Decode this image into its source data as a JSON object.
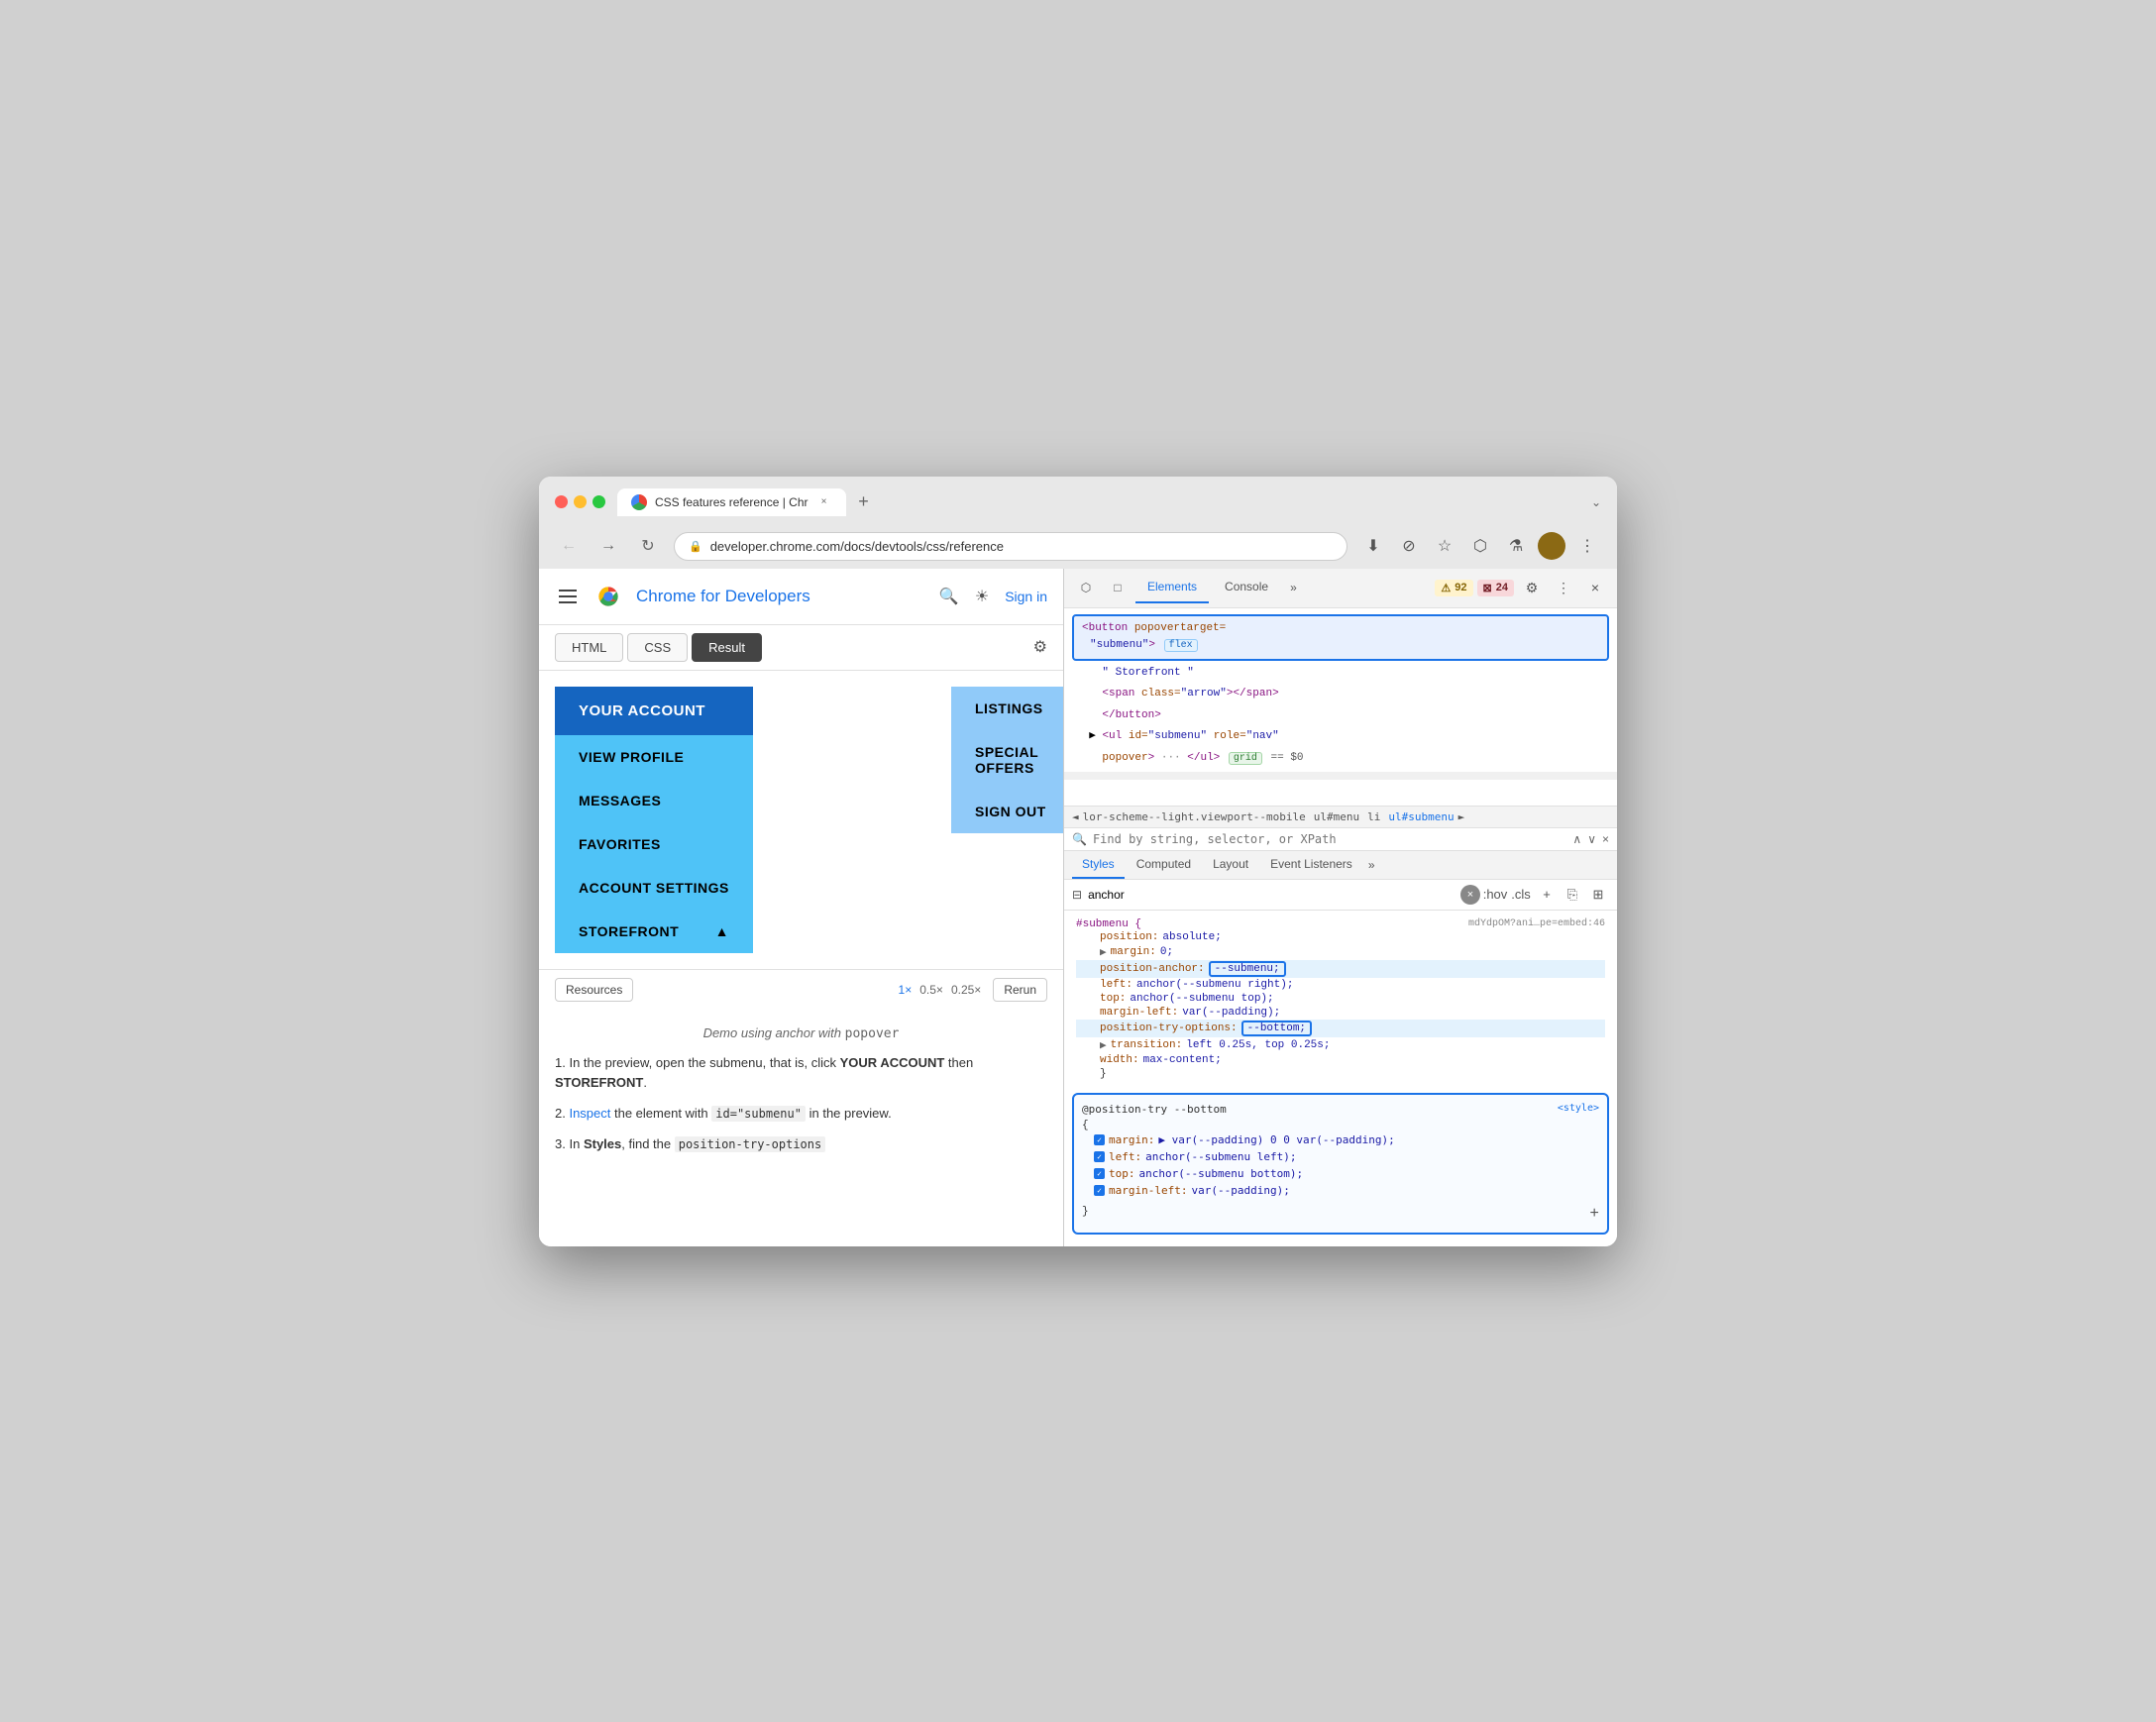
{
  "browser": {
    "tab_title": "CSS features reference | Chr",
    "tab_close": "×",
    "tab_add": "+",
    "url": "developer.chrome.com/docs/devtools/css/reference",
    "chevron": "⌄"
  },
  "nav": {
    "back": "←",
    "forward": "→",
    "refresh": "↻",
    "security_icon": "🔒"
  },
  "header": {
    "title": "Chrome for Developers",
    "sign_in": "Sign in"
  },
  "code_tabs": {
    "html": "HTML",
    "css": "CSS",
    "result": "Result"
  },
  "demo": {
    "your_account": "YOUR ACCOUNT",
    "menu_items": [
      "VIEW PROFILE",
      "MESSAGES",
      "FAVORITES",
      "ACCOUNT SETTINGS",
      "STOREFRONT"
    ],
    "storefront_arrow": "▲",
    "submenu_items": [
      "LISTINGS",
      "SPECIAL OFFERS",
      "SIGN OUT"
    ]
  },
  "controls": {
    "resources": "Resources",
    "zoom_1x": "1×",
    "zoom_05x": "0.5×",
    "zoom_025x": "0.25×",
    "rerun": "Rerun"
  },
  "description": {
    "caption_pre": "Demo using anchor with ",
    "caption_code": "popover",
    "step1_text": "In the preview, open the submenu, that is, click ",
    "step1_bold1": "YOUR ACCOUNT",
    "step1_mid": " then ",
    "step1_bold2": "STOREFRONT",
    "step1_end": ".",
    "step2_pre": "",
    "step2_link": "Inspect",
    "step2_mid": " the element with ",
    "step2_code": "id=\"submenu\"",
    "step2_end": " in the preview.",
    "step3_text": "In ",
    "step3_bold": "Styles",
    "step3_end": ", find the ",
    "step3_code": "position-try-options"
  },
  "devtools": {
    "panel_icons": [
      "⬡",
      "□",
      "×"
    ],
    "tabs": [
      "Elements",
      "Console",
      "»"
    ],
    "warning_count": "92",
    "error_count": "24",
    "settings_icon": "⚙",
    "more_icon": "⋮",
    "close": "×"
  },
  "elements_panel": {
    "line1_selected": "<button popovertarget=\"submenu\"> flex",
    "line2": "\" Storefront \"",
    "line3": "<span class=\"arrow\"></span>",
    "line4": "</button>",
    "line5": "<ul id=\"submenu\" role=\"nav\"",
    "line6": "popover> ··· </ul> grid  == $0"
  },
  "breadcrumb": {
    "items": [
      "◄",
      "lor-scheme--light.viewport--mobile",
      "ul#menu",
      "li",
      "ul#submenu",
      "►"
    ]
  },
  "search": {
    "placeholder": "Find by string, selector, or XPath",
    "up": "∧",
    "down": "∨",
    "close": "×"
  },
  "styles_tabs": {
    "tabs": [
      "Styles",
      "Computed",
      "Layout",
      "Event Listeners",
      "»"
    ]
  },
  "filter": {
    "placeholder": "anchor",
    "pseudo_class": ":hov",
    "cls": ".cls",
    "plus": "+",
    "copy_icon": "⎘",
    "layout_icon": "⊞"
  },
  "css_rules": {
    "selector": "#submenu {",
    "file_ref": "mdYdpOM?ani…pe=embed:46",
    "properties": [
      {
        "name": "position:",
        "value": "absolute;",
        "highlight": false
      },
      {
        "name": "margin:",
        "value": "▶ 0;",
        "highlight": false
      },
      {
        "name": "position-anchor:",
        "value": "--submenu;",
        "highlight": true,
        "value_highlight": true
      },
      {
        "name": "left:",
        "value": "anchor(--submenu right);",
        "highlight": false
      },
      {
        "name": "top:",
        "value": "anchor(--submenu top);",
        "highlight": false
      },
      {
        "name": "margin-left:",
        "value": "var(--padding);",
        "highlight": false
      },
      {
        "name": "position-try-options:",
        "value": "--bottom;",
        "highlight": true,
        "value_highlight": true
      },
      {
        "name": "transition:",
        "value": "▶ left 0.25s, top 0.25s;",
        "highlight": false
      },
      {
        "name": "width:",
        "value": "max-content;",
        "highlight": false
      }
    ]
  },
  "position_try": {
    "header": "@position-try --bottom",
    "style_link": "<style>",
    "properties": [
      {
        "text": "margin: ▶ var(--padding) 0 0 var(--padding);"
      },
      {
        "text": "left: anchor(--submenu left);"
      },
      {
        "text": "top: anchor(--submenu bottom);"
      },
      {
        "text": "margin-left: var(--padding);"
      }
    ]
  }
}
